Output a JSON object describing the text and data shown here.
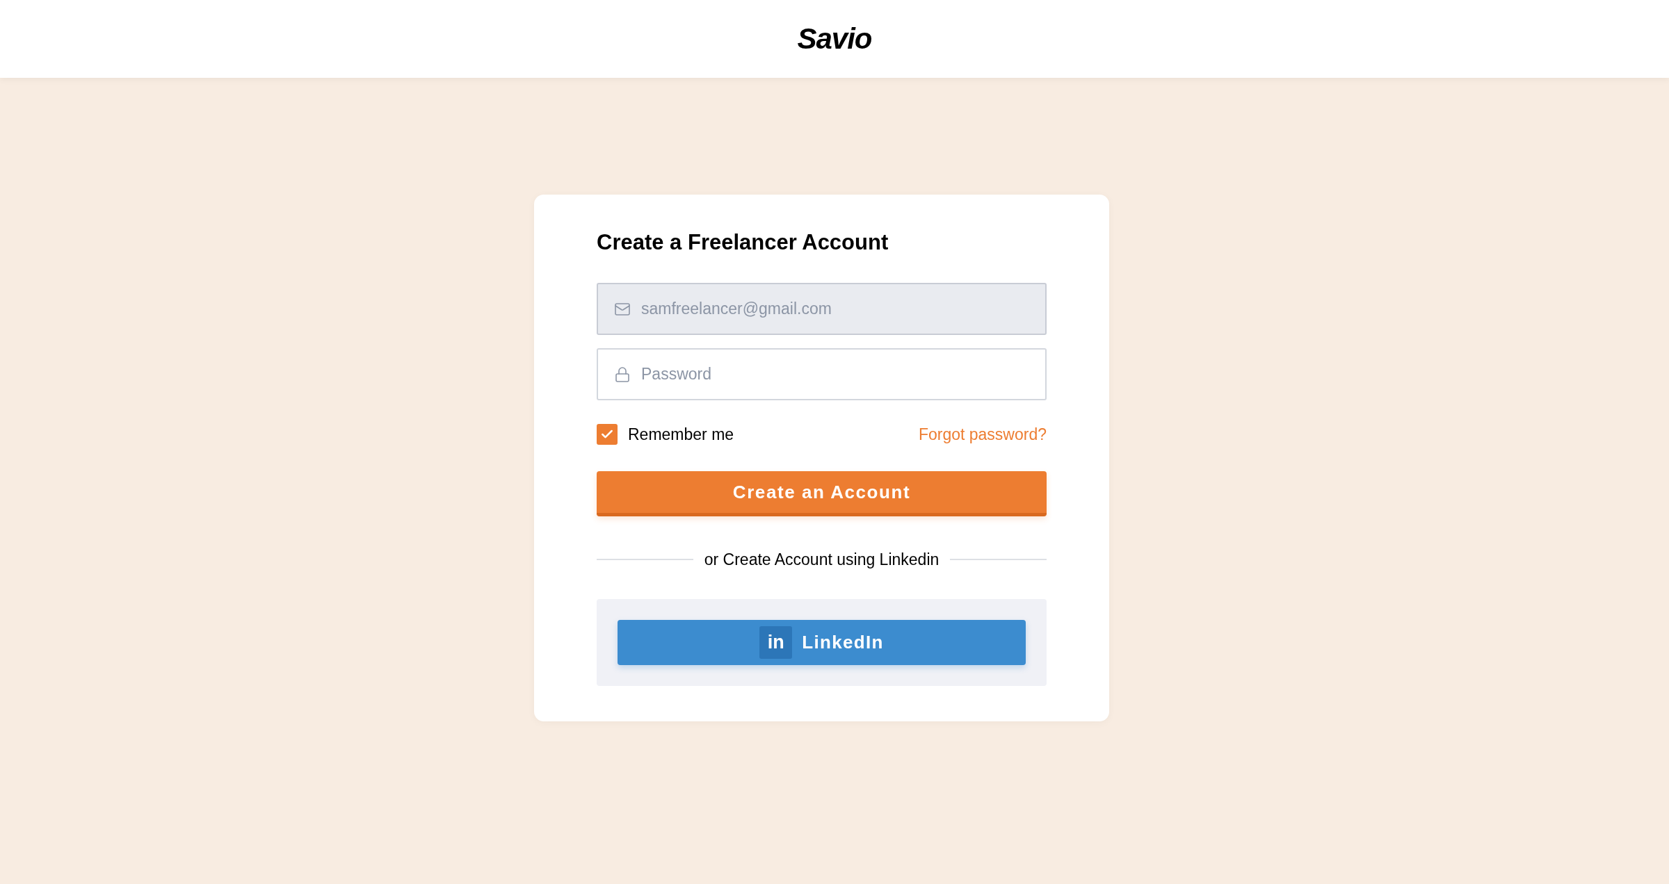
{
  "header": {
    "logo": "Savio"
  },
  "form": {
    "title": "Create a Freelancer Account",
    "fields": [
      {
        "kind": "email",
        "placeholder": "samfreelancer@gmail.com",
        "disabled": true
      },
      {
        "kind": "password",
        "placeholder": "Password",
        "disabled": false
      }
    ],
    "remember": {
      "label": "Remember me",
      "checked": true
    },
    "forgot_link": "Forgot password?",
    "submit": "Create an Account",
    "divider": "or Create Account using Linkedin",
    "linkedin_button": {
      "logo": "in",
      "label": "LinkedIn"
    }
  }
}
